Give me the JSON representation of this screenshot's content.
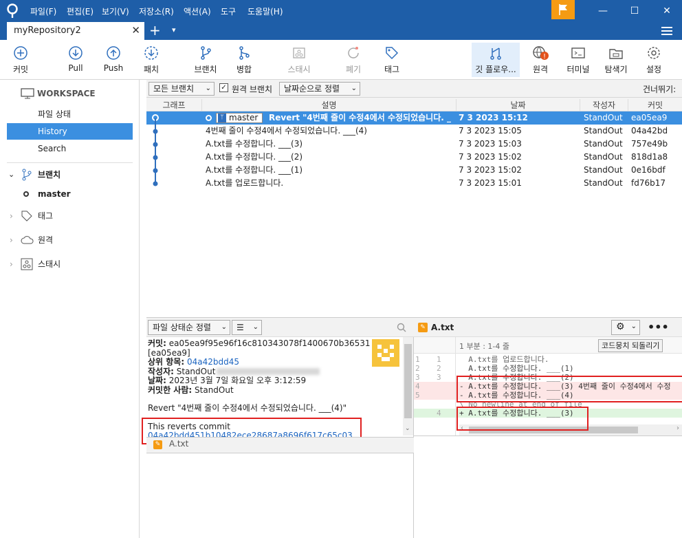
{
  "menu": [
    "파일(F)",
    "편집(E)",
    "보기(V)",
    "저장소(R)",
    "액션(A)",
    "도구",
    "도움말(H)"
  ],
  "tab": {
    "title": "myRepository2",
    "close": "✕",
    "add": "+",
    "more": "▾"
  },
  "window": {
    "minimize": "—",
    "maximize": "☐",
    "close": "✕"
  },
  "toolbar": {
    "commit": "커밋",
    "pull": "Pull",
    "push": "Push",
    "fetch": "패치",
    "branch": "브랜치",
    "merge": "병합",
    "stash": "스태시",
    "discard": "폐기",
    "tag": "태그",
    "gitflow": "깃 플로우...",
    "remote": "원격",
    "terminal": "터미널",
    "explorer": "탐색기",
    "settings": "설정"
  },
  "sidebar": {
    "workspace": "WORKSPACE",
    "file_status": "파일 상태",
    "history": "History",
    "search": "Search",
    "branches": "브랜치",
    "master": "master",
    "tags": "태그",
    "remotes": "원격",
    "stashes": "스태시"
  },
  "filter": {
    "all_branches": "모든 브랜치",
    "remote_branches": "원격 브랜치",
    "sort_by_date": "날짜순으로 정렬",
    "jump_to": "건너뛰기:"
  },
  "columns": {
    "graph": "그래프",
    "description": "설명",
    "date": "날짜",
    "author": "작성자",
    "commit": "커밋"
  },
  "commits": [
    {
      "branch": "master",
      "desc": "Revert \"4번째 줄이 수정4에서 수정되었습니다. _",
      "date": "7 3 2023 15:12",
      "author": "StandOut",
      "hash": "ea05ea9"
    },
    {
      "branch": "",
      "desc": "4번째 줄이 수정4에서 수정되었습니다. ___(4)",
      "date": "7 3 2023 15:05",
      "author": "StandOut",
      "hash": "04a42bd"
    },
    {
      "branch": "",
      "desc": "A.txt를 수정합니다. ___(3)",
      "date": "7 3 2023 15:03",
      "author": "StandOut",
      "hash": "757e49b"
    },
    {
      "branch": "",
      "desc": "A.txt를 수정합니다. ___(2)",
      "date": "7 3 2023 15:02",
      "author": "StandOut",
      "hash": "818d1a8"
    },
    {
      "branch": "",
      "desc": "A.txt를 수정합니다. ___(1)",
      "date": "7 3 2023 15:02",
      "author": "StandOut",
      "hash": "0e16bdf"
    },
    {
      "branch": "",
      "desc": "A.txt를 업로드합니다.",
      "date": "7 3 2023 15:01",
      "author": "StandOut",
      "hash": "fd76b17"
    }
  ],
  "details": {
    "sort_label": "파일 상태순 정렬",
    "view_label": "☰",
    "commit_label": "커밋:",
    "commit_hash": "ea05ea9f95e96f16c810343078f1400670b36531",
    "short_hash": "[ea05ea9]",
    "parent_label": "상위 항목:",
    "parent_hash": "04a42bdd45",
    "author_label": "작성자:",
    "author_value": "StandOut",
    "date_label": "날짜:",
    "date_value": "2023년 3월 7일 화요일 오후 3:12:59",
    "committer_label": "커밋한 사람:",
    "committer_value": "StandOut",
    "message": "Revert \"4번째 줄이 수정4에서 수정되었습니다. ___(4)\"",
    "reverts": "This reverts commit",
    "revert_hash": "04a42bdd451b10482ece28687a8696f617c65c03",
    "revert_dot": ".",
    "file": "A.txt"
  },
  "diff": {
    "file": "A.txt",
    "hunk": "1 부분 : 1-4 줄",
    "revert_hunk": "코드뭉치 되돌리기",
    "lines": [
      {
        "old": "1",
        "new": "1",
        "text": "  A.txt를 업로드합니다.",
        "kind": "ctx"
      },
      {
        "old": "2",
        "new": "2",
        "text": "  A.txt를 수정합니다. ___(1)",
        "kind": "ctx"
      },
      {
        "old": "3",
        "new": "3",
        "text": "  A.txt를 수정합니다. ___(2)",
        "kind": "ctx"
      },
      {
        "old": "4",
        "new": "",
        "text": "- A.txt를 수정합니다. ___(3) 4번째 줄이 수정4에서 수정",
        "kind": "del"
      },
      {
        "old": "5",
        "new": "",
        "text": "- A.txt를 수정합니다. ___(4)",
        "kind": "del"
      },
      {
        "old": "",
        "new": "",
        "text": "\\ No newline at end of file",
        "kind": "meta"
      },
      {
        "old": "",
        "new": "4",
        "text": "+ A.txt를 수정합니다. ___(3)",
        "kind": "add"
      }
    ]
  },
  "colors": {
    "accent": "#1e5ea8",
    "selection": "#3b8fe0",
    "graph": "#2f6fbd",
    "flag": "#f59b13",
    "highlight": "#e02020"
  }
}
